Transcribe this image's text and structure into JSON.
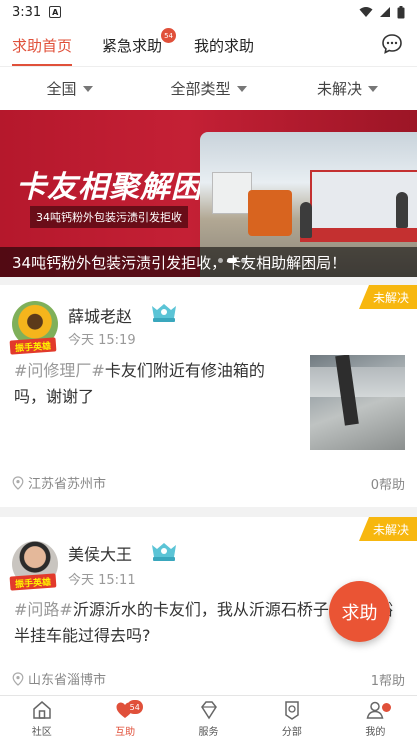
{
  "status_bar": {
    "time": "3:31",
    "notification_letter": "A"
  },
  "header": {
    "tabs": [
      {
        "label": "求助首页",
        "active": true
      },
      {
        "label": "紧急求助",
        "badge": "54"
      },
      {
        "label": "我的求助"
      }
    ],
    "chat_icon": "chat-bubble-icon"
  },
  "filters": [
    {
      "label": "全国"
    },
    {
      "label": "全部类型"
    },
    {
      "label": "未解决"
    }
  ],
  "banner": {
    "title": "卡友相聚解困局!",
    "subtitle": "34吨钙粉外包装污渍引发拒收",
    "caption": "34吨钙粉外包装污渍引发拒收，卡友相助解困局！",
    "slides_total": 3,
    "slide_active": 1
  },
  "posts": [
    {
      "status": "未解决",
      "avatar_tag": "振手英雄",
      "username": "薛城老赵",
      "time": "今天 15:19",
      "hashtag": "#问修理厂#",
      "content": "卡友们附近有修油箱的吗，谢谢了",
      "location": "江苏省苏州市",
      "help_count": "0帮助"
    },
    {
      "status": "未解决",
      "avatar_tag": "振手英雄",
      "username": "美侯大王",
      "time": "今天 15:11",
      "hashtag": "#问路#",
      "content": "沂源沂水的卡友们，我从沂源石桥子水崔家峪半挂车能过得去吗?",
      "location": "山东省淄博市",
      "help_count": "1帮助"
    }
  ],
  "fab": {
    "label": "求助"
  },
  "bottom_nav": [
    {
      "label": "社区",
      "icon": "community-icon"
    },
    {
      "label": "互助",
      "icon": "heart-hands-icon",
      "badge": "54",
      "active": true
    },
    {
      "label": "服务",
      "icon": "diamond-icon"
    },
    {
      "label": "分部",
      "icon": "branch-icon"
    },
    {
      "label": "我的",
      "icon": "person-icon",
      "dot": true
    }
  ],
  "colors": {
    "accent": "#e0503a",
    "ribbon": "#f7b70f",
    "banner": "#b5182c"
  }
}
